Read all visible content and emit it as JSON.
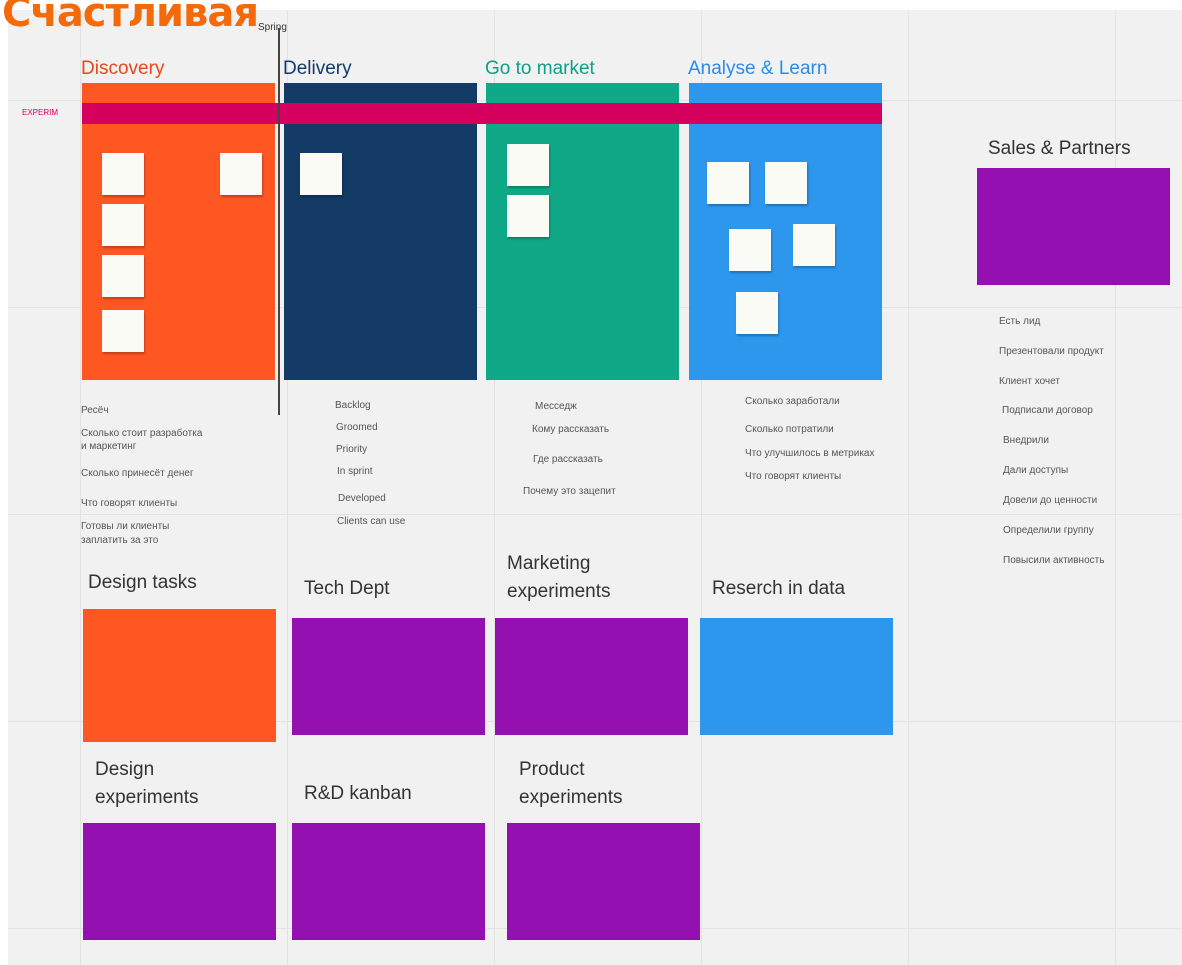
{
  "brand": {
    "text": "Счастливая",
    "color": "#f26a0a"
  },
  "spring_label": "Spring",
  "experiment_label": "EXPERIM",
  "band_color": "#d6005e",
  "columns": [
    {
      "title": "Discovery",
      "title_color": "#e8471c",
      "color": "#fe5722",
      "notes": [
        "Ресёч",
        "Сколько стоит разработка\nи маркетинг",
        "Сколько принесёт денег",
        "Что говорят клиенты",
        "Готовы ли клиенты\nзаплатить за это"
      ]
    },
    {
      "title": "Delivery",
      "title_color": "#123b6b",
      "color": "#143a66",
      "notes": [
        "Backlog",
        "Groomed",
        "Priority",
        "In sprint",
        "Developed",
        "Clients can use"
      ]
    },
    {
      "title": "Go to market",
      "title_color": "#0f9f86",
      "color": "#10a987",
      "notes": [
        "Месседж",
        "Кому рассказать",
        "Где рассказать",
        "Почему это зацепит"
      ]
    },
    {
      "title": "Analyse & Learn",
      "title_color": "#2b8ce6",
      "color": "#2d97ee",
      "notes": [
        "Сколько заработали",
        "Сколько потратили",
        "Что улучшилось в метриках",
        "Что говорят клиенты"
      ]
    }
  ],
  "sales": {
    "title": "Sales & Partners",
    "color": "#9410b0",
    "steps": [
      "Есть лид",
      "Презентовали продукт",
      "Клиент хочет",
      "Подписали договор",
      "Внедрили",
      "Дали доступы",
      "Довели до ценности",
      "Определили группу",
      "Повысили активность"
    ]
  },
  "sections": [
    {
      "title": "Design tasks",
      "color": "#fe5722"
    },
    {
      "title": "Tech Dept",
      "color": "#9410b0"
    },
    {
      "title": "Marketing\nexperiments",
      "color": "#9410b0"
    },
    {
      "title": "Reserch in data",
      "color": "#2d97ee"
    },
    {
      "title": "Design\nexperiments",
      "color": "#9410b0"
    },
    {
      "title": "R&D kanban",
      "color": "#9410b0"
    },
    {
      "title": "Product\nexperiments",
      "color": "#9410b0"
    }
  ]
}
